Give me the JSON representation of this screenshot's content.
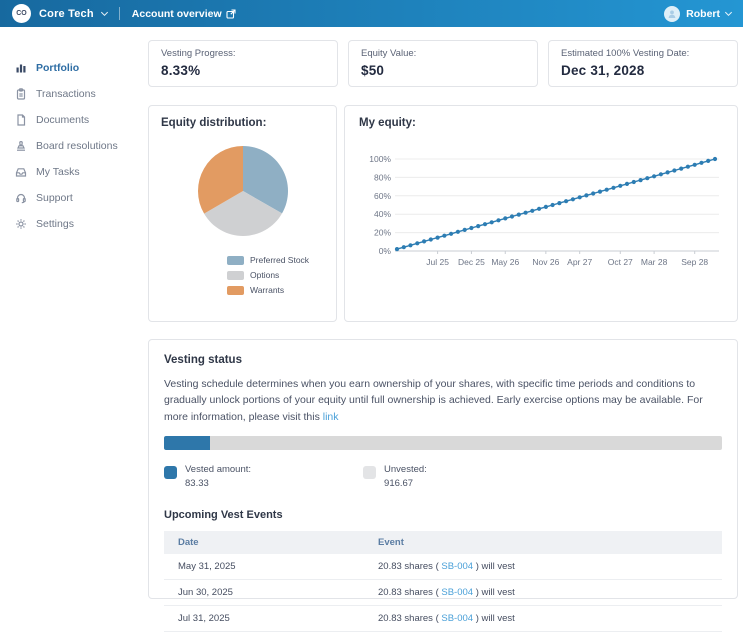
{
  "header": {
    "company_initials": "CO",
    "company_name": "Core Tech",
    "breadcrumb": "Account overview",
    "user_name": "Robert",
    "bar_color_left": "#17699f",
    "bar_color_right": "#2496d3"
  },
  "sidebar": {
    "items": [
      {
        "label": "Portfolio",
        "icon": "portfolio-icon",
        "active": true
      },
      {
        "label": "Transactions",
        "icon": "transactions-icon",
        "active": false
      },
      {
        "label": "Documents",
        "icon": "documents-icon",
        "active": false
      },
      {
        "label": "Board resolutions",
        "icon": "board-resolutions-icon",
        "active": false
      },
      {
        "label": "My Tasks",
        "icon": "my-tasks-icon",
        "active": false
      },
      {
        "label": "Support",
        "icon": "support-icon",
        "active": false
      },
      {
        "label": "Settings",
        "icon": "settings-icon",
        "active": false
      }
    ]
  },
  "stats": [
    {
      "label": "Vesting Progress:",
      "value": "8.33%"
    },
    {
      "label": "Equity Value:",
      "value": "$50"
    },
    {
      "label": "Estimated 100% Vesting Date:",
      "value": "Dec 31, 2028"
    }
  ],
  "chart_data": [
    {
      "type": "pie",
      "title": "Equity distribution:",
      "labels": [
        "Preferred Stock",
        "Options",
        "Warrants"
      ],
      "values": [
        33.3,
        33.3,
        33.4
      ],
      "colors": [
        "#8fafc4",
        "#cfd0d2",
        "#e29b62"
      ],
      "legend_position": "bottom",
      "start_angle_deg": 0
    },
    {
      "type": "line",
      "title": "My equity:",
      "color": "#2d7db3",
      "marker": "circle",
      "ylabel": "",
      "ylim": [
        0,
        100
      ],
      "y_ticks": [
        "0%",
        "20%",
        "40%",
        "60%",
        "80%",
        "100%"
      ],
      "x_tick_labels": [
        "Jul 25",
        "Dec 25",
        "May 26",
        "Nov 26",
        "Apr 27",
        "Oct 27",
        "Mar 28",
        "Sep 28"
      ],
      "x_tick_months": [
        7,
        12,
        17,
        23,
        28,
        34,
        39,
        45
      ],
      "x_total_points": 48,
      "values": [
        2.08,
        4.17,
        6.25,
        8.33,
        10.42,
        12.5,
        14.58,
        16.67,
        18.75,
        20.83,
        22.92,
        25,
        27.08,
        29.17,
        31.25,
        33.33,
        35.42,
        37.5,
        39.58,
        41.67,
        43.75,
        45.83,
        47.92,
        50,
        52.08,
        54.17,
        56.25,
        58.33,
        60.42,
        62.5,
        64.58,
        66.67,
        68.75,
        70.83,
        72.92,
        75,
        77.08,
        79.17,
        81.25,
        83.33,
        85.42,
        87.5,
        89.58,
        91.67,
        93.75,
        95.83,
        97.92,
        100
      ]
    }
  ],
  "vesting": {
    "title": "Vesting status",
    "description": "Vesting schedule determines when you earn ownership of your shares, with specific time periods and conditions to gradually unlock portions of your equity until full ownership is achieved. Early exercise options may be available. For more information, please visit this ",
    "link_text": "link",
    "progress_percent": 8.33,
    "progress_fill_color": "#2e77aa",
    "vested_label": "Vested amount:",
    "vested_value": "83.33",
    "unvested_label": "Unvested:",
    "unvested_value": "916.67",
    "events_title": "Upcoming Vest Events",
    "table": {
      "columns": [
        "Date",
        "Event"
      ],
      "rows": [
        {
          "date": "May 31, 2025",
          "event_pre": "20.83 shares ( ",
          "event_link": "SB-004",
          "event_post": " ) will vest"
        },
        {
          "date": "Jun 30, 2025",
          "event_pre": "20.83 shares ( ",
          "event_link": "SB-004",
          "event_post": " ) will vest"
        },
        {
          "date": "Jul 31, 2025",
          "event_pre": "20.83 shares ( ",
          "event_link": "SB-004",
          "event_post": " ) will vest"
        }
      ]
    }
  }
}
